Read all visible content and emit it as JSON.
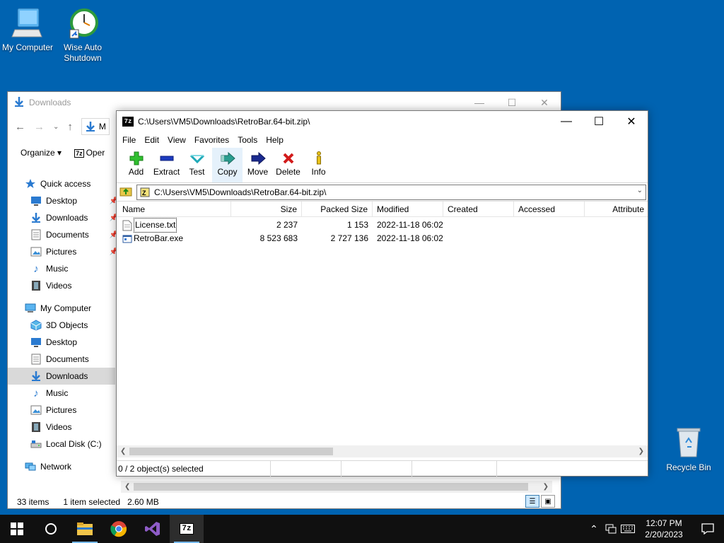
{
  "desktop": {
    "icons": [
      {
        "label": "My Computer"
      },
      {
        "label": "Wise Auto Shutdown"
      },
      {
        "label": "Recycle Bin"
      }
    ]
  },
  "explorer": {
    "title": "Downloads",
    "path_partial": "M",
    "ribbon": {
      "organize": "Organize",
      "open": "Oper"
    },
    "sidebar": [
      {
        "label": "Quick access",
        "level": 1,
        "icon": "star-icon"
      },
      {
        "label": "Desktop",
        "level": 2,
        "icon": "desktop-icon",
        "pinned": true
      },
      {
        "label": "Downloads",
        "level": 2,
        "icon": "download-icon",
        "pinned": true
      },
      {
        "label": "Documents",
        "level": 2,
        "icon": "document-icon",
        "pinned": true
      },
      {
        "label": "Pictures",
        "level": 2,
        "icon": "picture-icon",
        "pinned": true
      },
      {
        "label": "Music",
        "level": 2,
        "icon": "music-icon"
      },
      {
        "label": "Videos",
        "level": 2,
        "icon": "video-icon"
      },
      {
        "label": "My Computer",
        "level": 1,
        "icon": "computer-icon"
      },
      {
        "label": "3D Objects",
        "level": 2,
        "icon": "cube-icon"
      },
      {
        "label": "Desktop",
        "level": 2,
        "icon": "desktop-icon"
      },
      {
        "label": "Documents",
        "level": 2,
        "icon": "document-icon"
      },
      {
        "label": "Downloads",
        "level": 2,
        "icon": "download-icon",
        "selected": true
      },
      {
        "label": "Music",
        "level": 2,
        "icon": "music-icon"
      },
      {
        "label": "Pictures",
        "level": 2,
        "icon": "picture-icon"
      },
      {
        "label": "Videos",
        "level": 2,
        "icon": "video-icon"
      },
      {
        "label": "Local Disk (C:)",
        "level": 2,
        "icon": "disk-icon"
      },
      {
        "label": "Network",
        "level": 1,
        "icon": "network-icon"
      }
    ],
    "status": {
      "items": "33 items",
      "selected": "1 item selected",
      "size": "2.60 MB"
    }
  },
  "zip": {
    "title": "C:\\Users\\VM5\\Downloads\\RetroBar.64-bit.zip\\",
    "menu": [
      "File",
      "Edit",
      "View",
      "Favorites",
      "Tools",
      "Help"
    ],
    "toolbar": [
      {
        "label": "Add",
        "icon": "add-icon"
      },
      {
        "label": "Extract",
        "icon": "extract-icon"
      },
      {
        "label": "Test",
        "icon": "test-icon"
      },
      {
        "label": "Copy",
        "icon": "copy-icon"
      },
      {
        "label": "Move",
        "icon": "move-icon"
      },
      {
        "label": "Delete",
        "icon": "delete-icon"
      },
      {
        "label": "Info",
        "icon": "info-icon"
      }
    ],
    "address": "C:\\Users\\VM5\\Downloads\\RetroBar.64-bit.zip\\",
    "columns": [
      "Name",
      "Size",
      "Packed Size",
      "Modified",
      "Created",
      "Accessed",
      "Attribute"
    ],
    "files": [
      {
        "name": "License.txt",
        "size": "2 237",
        "packed": "1 153",
        "modified": "2022-11-18 06:02",
        "icon": "text-file-icon"
      },
      {
        "name": "RetroBar.exe",
        "size": "8 523 683",
        "packed": "2 727 136",
        "modified": "2022-11-18 06:02",
        "icon": "exe-file-icon"
      }
    ],
    "status": "0 / 2 object(s) selected"
  },
  "taskbar": {
    "clock_time": "12:07 PM",
    "clock_date": "2/20/2023"
  },
  "colors": {
    "desktop": "#0063b1",
    "taskbar": "#101010",
    "selection": "#d9d9d9"
  }
}
